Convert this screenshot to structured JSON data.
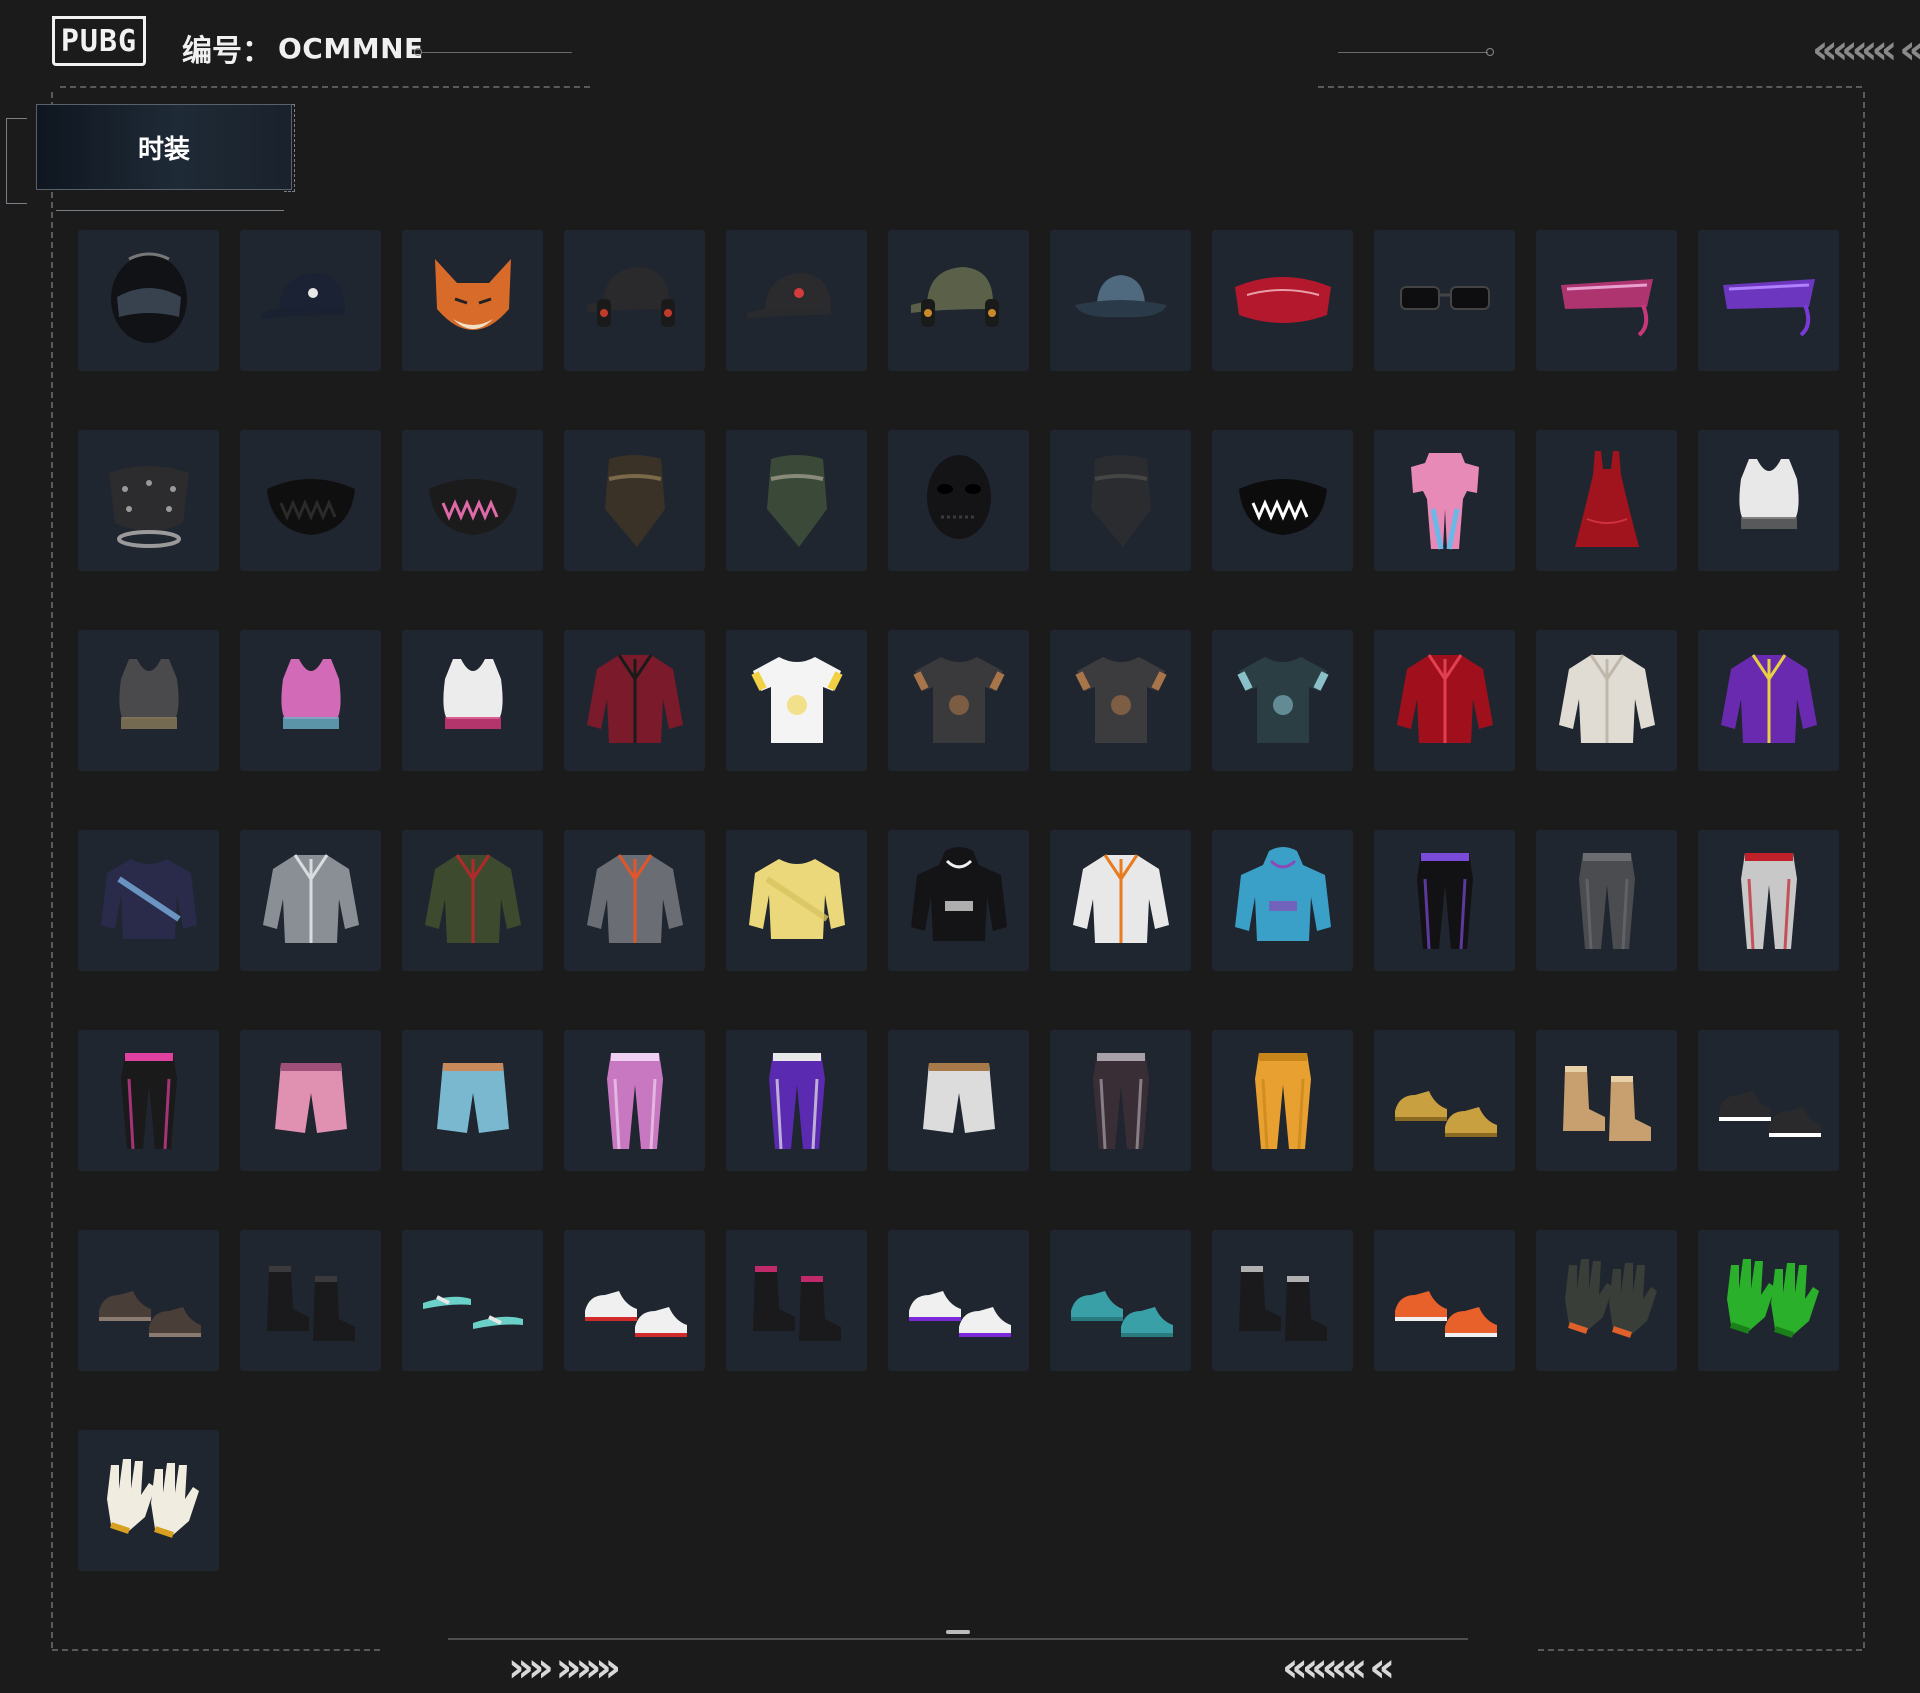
{
  "header": {
    "logo_text": "PUBG",
    "code_label": "编号：",
    "code_value": "OCMMNE"
  },
  "tab": {
    "label": "时装"
  },
  "decor": {
    "chevrons_top_right": "«««« «",
    "chevrons_bottom_left": "»» »»»",
    "chevrons_bottom_right": "«««« «"
  },
  "colors": {
    "background": "#1b1b1c",
    "cell": "#1f2630",
    "tab_gradient_start": "#0f1620",
    "tab_gradient_end": "#1e2a36"
  },
  "items": [
    {
      "name": "motorcycle-helmet-black",
      "icon": "helmet",
      "color": "#101215",
      "accent": "#4a5566"
    },
    {
      "name": "baseball-cap-navy",
      "icon": "cap",
      "color": "#1a2233",
      "accent": "#e8e8e8"
    },
    {
      "name": "fox-mask",
      "icon": "fox",
      "color": "#d86a2a",
      "accent": "#f0e0c8"
    },
    {
      "name": "cap-with-headphones",
      "icon": "cap-headset",
      "color": "#2a2a2c",
      "accent": "#c0392b"
    },
    {
      "name": "baseball-cap-black-red",
      "icon": "cap",
      "color": "#2b2b2d",
      "accent": "#d23c3c"
    },
    {
      "name": "military-cap-headset",
      "icon": "cap-headset",
      "color": "#5a6148",
      "accent": "#c88a2a"
    },
    {
      "name": "bucket-hat-denim",
      "icon": "bucket-hat",
      "color": "#4f6a7e",
      "accent": "#2a3a48"
    },
    {
      "name": "red-eye-mask",
      "icon": "eyemask",
      "color": "#b3182c",
      "accent": "#e8a0a8"
    },
    {
      "name": "black-sunglasses",
      "icon": "glasses",
      "color": "#0e0e10",
      "accent": "#444"
    },
    {
      "name": "cyber-visor-pink",
      "icon": "visor",
      "color": "#c8377a",
      "accent": "#e8a0d0"
    },
    {
      "name": "purple-headband-visor",
      "icon": "visor",
      "color": "#7a3ad8",
      "accent": "#b080ff"
    },
    {
      "name": "spiked-mask-miramar",
      "icon": "mask-spiked",
      "color": "#2c2c2e",
      "accent": "#9a9a9a"
    },
    {
      "name": "black-face-mask",
      "icon": "facemask",
      "color": "#0f0f10",
      "accent": "#2a2a2a"
    },
    {
      "name": "pink-skull-mask",
      "icon": "facemask",
      "color": "#1b1b1b",
      "accent": "#e06aa8"
    },
    {
      "name": "camo-bandana",
      "icon": "bandana",
      "color": "#3a3226",
      "accent": "#7a6a4a"
    },
    {
      "name": "camo-neck-gaiter",
      "icon": "bandana",
      "color": "#3b4a38",
      "accent": "#8a8a7a"
    },
    {
      "name": "black-stitched-mask",
      "icon": "face",
      "color": "#141416",
      "accent": "#3a3a3a"
    },
    {
      "name": "dark-hood-scarf",
      "icon": "bandana",
      "color": "#2a2c2f",
      "accent": "#454545"
    },
    {
      "name": "teeth-face-mask",
      "icon": "facemask",
      "color": "#0c0c0d",
      "accent": "#ffffff"
    },
    {
      "name": "pink-tracksuit",
      "icon": "jumpsuit",
      "color": "#e88ab8",
      "accent": "#6ab8e8"
    },
    {
      "name": "red-dress",
      "icon": "dress",
      "color": "#a1141e",
      "accent": "#d03040"
    },
    {
      "name": "white-crop-top",
      "icon": "croptop",
      "color": "#e8e8e8",
      "accent": "#666"
    },
    {
      "name": "grey-bra-belt",
      "icon": "croptop",
      "color": "#4a4a4c",
      "accent": "#8a7a5a"
    },
    {
      "name": "pink-tie-dye-top",
      "icon": "croptop",
      "color": "#d36ab8",
      "accent": "#6ab0c8"
    },
    {
      "name": "white-black-crop-arm",
      "icon": "croptop",
      "color": "#ececec",
      "accent": "#d83a7a"
    },
    {
      "name": "striped-spiderweb-jacket",
      "icon": "jacket",
      "color": "#7a1a2a",
      "accent": "#1a1a1a"
    },
    {
      "name": "chick-print-tee",
      "icon": "tshirt",
      "color": "#f4f4f4",
      "accent": "#f2d244"
    },
    {
      "name": "tattoo-sleeve-tee",
      "icon": "tshirt",
      "color": "#3a3a3c",
      "accent": "#a8744a"
    },
    {
      "name": "tattoo-sleeve-tee-2",
      "icon": "tshirt",
      "color": "#3c3c3e",
      "accent": "#a8744a"
    },
    {
      "name": "floral-shirt",
      "icon": "tshirt",
      "color": "#2a3e44",
      "accent": "#8ac0c8"
    },
    {
      "name": "red-satin-robe",
      "icon": "jacket",
      "color": "#a0101c",
      "accent": "#e04050"
    },
    {
      "name": "white-leather-jacket",
      "icon": "jacket",
      "color": "#e0dcd4",
      "accent": "#bfb7aa"
    },
    {
      "name": "purple-windbreaker",
      "icon": "jacket",
      "color": "#6a2ab0",
      "accent": "#e8d040"
    },
    {
      "name": "navy-sweatshirt-sash",
      "icon": "sweater",
      "color": "#2a2a4a",
      "accent": "#7ab0e0"
    },
    {
      "name": "grey-hooded-coat",
      "icon": "jacket",
      "color": "#8a8f96",
      "accent": "#d8dce0"
    },
    {
      "name": "green-bomber-crop",
      "icon": "jacket",
      "color": "#3e4a2e",
      "accent": "#b02a2a"
    },
    {
      "name": "grey-orange-jacket",
      "icon": "jacket",
      "color": "#6a6e74",
      "accent": "#e2552a"
    },
    {
      "name": "yellow-fuzzy-sweater",
      "icon": "sweater",
      "color": "#ead87a",
      "accent": "#d8c460"
    },
    {
      "name": "black-checker-hoodie",
      "icon": "hoodie",
      "color": "#141416",
      "accent": "#f0f0f0"
    },
    {
      "name": "white-orange-jacket",
      "icon": "jacket",
      "color": "#e8e8e8",
      "accent": "#e87a20"
    },
    {
      "name": "bunny-ear-hoodie",
      "icon": "hoodie",
      "color": "#3aa0c8",
      "accent": "#8a4ab8"
    },
    {
      "name": "black-track-pants",
      "icon": "pants",
      "color": "#121214",
      "accent": "#7a4ad8"
    },
    {
      "name": "grey-skinny-pants",
      "icon": "pants",
      "color": "#4a4c50",
      "accent": "#6a6c70"
    },
    {
      "name": "white-armored-pants",
      "icon": "pants",
      "color": "#c8c8c8",
      "accent": "#c0202a"
    },
    {
      "name": "black-chaps",
      "icon": "pants",
      "color": "#1a1a1a",
      "accent": "#e040a0"
    },
    {
      "name": "pink-plaid-shorts",
      "icon": "shorts",
      "color": "#e090b0",
      "accent": "#a05078"
    },
    {
      "name": "denim-shorts",
      "icon": "shorts",
      "color": "#7ab8d0",
      "accent": "#c88a5a"
    },
    {
      "name": "pink-graphic-pants",
      "icon": "pants",
      "color": "#c878c0",
      "accent": "#f0d0f0"
    },
    {
      "name": "purple-skirt-leggings",
      "icon": "pants",
      "color": "#5a2ab0",
      "accent": "#e8e8e8"
    },
    {
      "name": "white-cargo-shorts",
      "icon": "shorts",
      "color": "#dcdcdc",
      "accent": "#a87a4a"
    },
    {
      "name": "camo-pants",
      "icon": "pants",
      "color": "#3a2e36",
      "accent": "#a8a0a8"
    },
    {
      "name": "yellow-joggers",
      "icon": "pants",
      "color": "#e8a030",
      "accent": "#c8861a"
    },
    {
      "name": "gold-shoes",
      "icon": "shoes",
      "color": "#c8a040",
      "accent": "#8a6a20"
    },
    {
      "name": "tan-boots",
      "icon": "boots",
      "color": "#c8a070",
      "accent": "#e8d0a8"
    },
    {
      "name": "black-white-sneakers",
      "icon": "shoes",
      "color": "#2a2a2c",
      "accent": "#ffffff"
    },
    {
      "name": "paw-slippers",
      "icon": "shoes",
      "color": "#4a3e38",
      "accent": "#8a7a70"
    },
    {
      "name": "black-ankle-boots",
      "icon": "boots",
      "color": "#1a1a1c",
      "accent": "#3a3a3c"
    },
    {
      "name": "teal-flip-flops",
      "icon": "sandals",
      "color": "#6ad0c8",
      "accent": "#e8e8e8"
    },
    {
      "name": "white-sneakers",
      "icon": "shoes",
      "color": "#f0f0f0",
      "accent": "#d02a2a"
    },
    {
      "name": "striped-platform-boots",
      "icon": "boots",
      "color": "#1a1a1c",
      "accent": "#c02a6a"
    },
    {
      "name": "purple-white-sneakers",
      "icon": "shoes",
      "color": "#f0f0f0",
      "accent": "#7a2ad8"
    },
    {
      "name": "teal-clogs",
      "icon": "shoes",
      "color": "#3aa0a8",
      "accent": "#2a7a80"
    },
    {
      "name": "fur-trim-boots",
      "icon": "boots",
      "color": "#1a1a1c",
      "accent": "#b0b0b0"
    },
    {
      "name": "orange-high-tops",
      "icon": "shoes",
      "color": "#e8602a",
      "accent": "#f0f0f0"
    },
    {
      "name": "tactical-gloves",
      "icon": "gloves",
      "color": "#3a3e38",
      "accent": "#e0602a"
    },
    {
      "name": "green-gloves",
      "icon": "gloves",
      "color": "#2ab02a",
      "accent": "#1a801a"
    },
    {
      "name": "work-gloves",
      "icon": "gloves",
      "color": "#f0ece0",
      "accent": "#d8a020"
    }
  ]
}
